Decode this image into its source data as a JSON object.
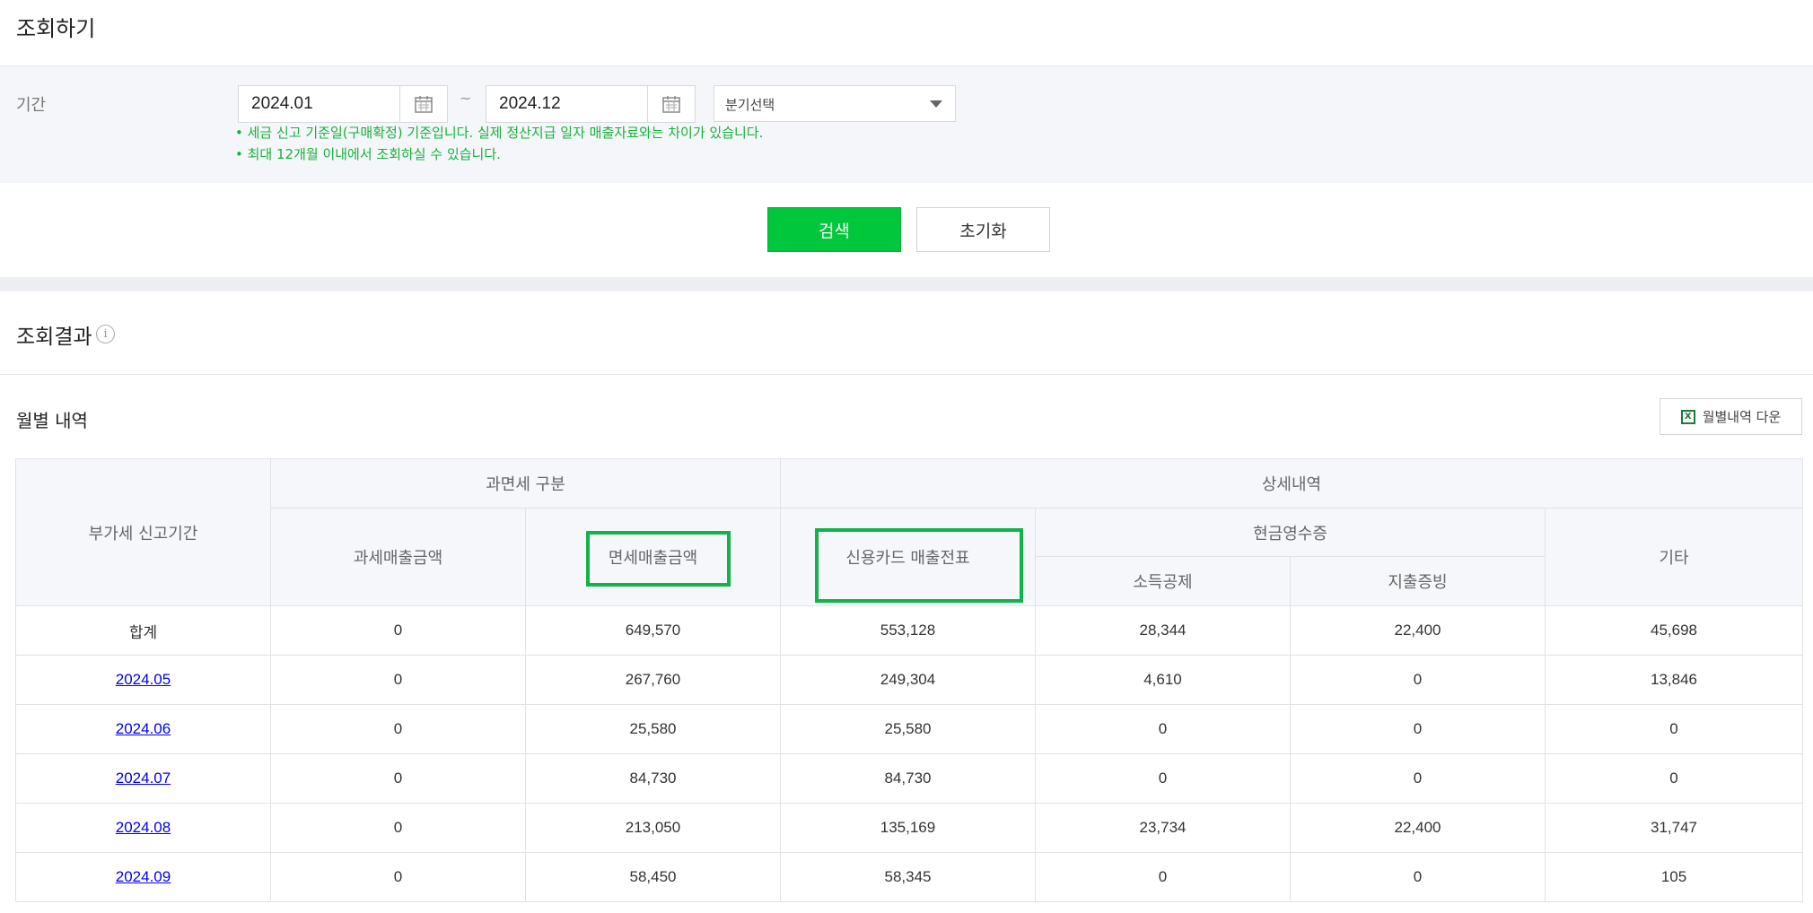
{
  "page": {
    "title": "조회하기"
  },
  "filter": {
    "period_label": "기간",
    "start_date": "2024.01",
    "end_date": "2024.12",
    "tilde": "~",
    "quarter_select": "분기선택",
    "notices": [
      "• 세금 신고 기준일(구매확정) 기준입니다. 실제 정산지급 일자 매출자료와는 차이가 있습니다.",
      "• 최대 12개월 이내에서 조회하실 수 있습니다."
    ]
  },
  "actions": {
    "search_label": "검색",
    "reset_label": "초기화"
  },
  "results": {
    "title": "조회결과",
    "info_icon": "i",
    "monthly_title": "월별 내역",
    "download_label": "월별내역 다운",
    "download_icon": "X"
  },
  "table": {
    "headers": {
      "period": "부가세 신고기간",
      "tax_group": "과면세 구분",
      "taxable": "과세매출금액",
      "exempt": "면세매출금액",
      "detail_group": "상세내역",
      "credit_card": "신용카드 매출전표",
      "cash_receipt": "현금영수증",
      "income_deduction": "소득공제",
      "expense_proof": "지출증빙",
      "other": "기타"
    },
    "rows": [
      {
        "period": "합계",
        "taxable": "0",
        "exempt": "649,570",
        "credit_card": "553,128",
        "income_deduction": "28,344",
        "expense_proof": "22,400",
        "other": "45,698"
      },
      {
        "period": "2024.05",
        "taxable": "0",
        "exempt": "267,760",
        "credit_card": "249,304",
        "income_deduction": "4,610",
        "expense_proof": "0",
        "other": "13,846"
      },
      {
        "period": "2024.06",
        "taxable": "0",
        "exempt": "25,580",
        "credit_card": "25,580",
        "income_deduction": "0",
        "expense_proof": "0",
        "other": "0"
      },
      {
        "period": "2024.07",
        "taxable": "0",
        "exempt": "84,730",
        "credit_card": "84,730",
        "income_deduction": "0",
        "expense_proof": "0",
        "other": "0"
      },
      {
        "period": "2024.08",
        "taxable": "0",
        "exempt": "213,050",
        "credit_card": "135,169",
        "income_deduction": "23,734",
        "expense_proof": "22,400",
        "other": "31,747"
      },
      {
        "period": "2024.09",
        "taxable": "0",
        "exempt": "58,450",
        "credit_card": "58,345",
        "income_deduction": "0",
        "expense_proof": "0",
        "other": "105"
      }
    ]
  },
  "colors": {
    "accent_green": "#00c73c",
    "highlight_green": "#12b24a",
    "notice_green": "#17b23a",
    "link_blue": "#0000ee"
  }
}
